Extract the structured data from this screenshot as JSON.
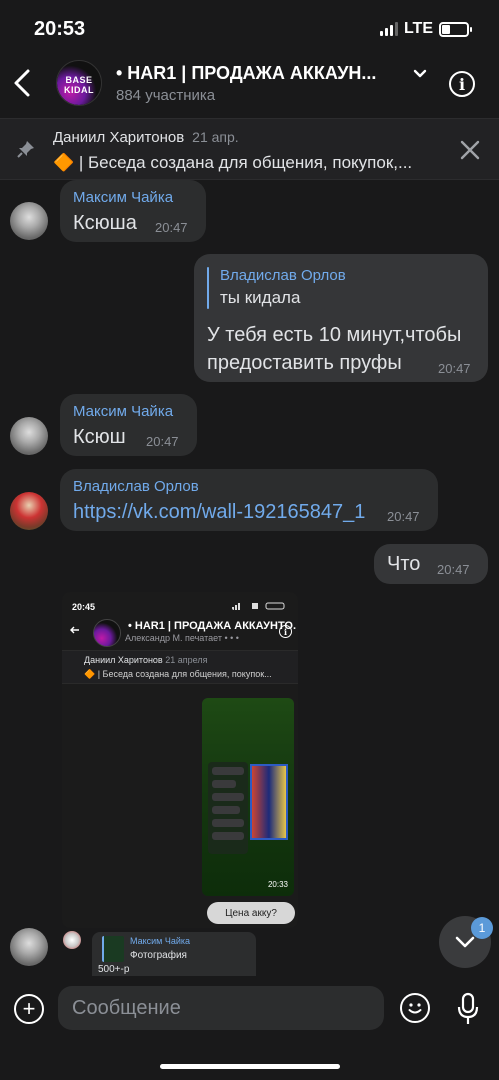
{
  "status_bar": {
    "time": "20:53",
    "network": "LTE"
  },
  "header": {
    "avatar_line1": "BASE",
    "avatar_line2": "KIDAL",
    "title": "• HAR1 | ПРОДАЖА АККАУН...",
    "subtitle": "884 участника"
  },
  "pinned": {
    "author": "Даниил Харитонов",
    "date": "21 апр.",
    "text": "🔶 | Беседа создана для общения, покупок,..."
  },
  "messages": [
    {
      "sender": "Максим Чайка",
      "text": "Ксюша",
      "time": "20:47"
    },
    {
      "reply_author": "Владислав Орлов",
      "reply_text": "ты кидала",
      "text_line1": "У тебя есть 10 минут,чтобы",
      "text_line2": "предоставить пруфы",
      "time": "20:47"
    },
    {
      "sender": "Максим Чайка",
      "text": "Ксюш",
      "time": "20:47"
    },
    {
      "sender": "Владислав Орлов",
      "text": "https://vk.com/wall-192165847_1",
      "time": "20:47"
    },
    {
      "text": "Что",
      "time": "20:47"
    }
  ],
  "screenshot": {
    "time": "20:45",
    "title": "• HAR1 | ПРОДАЖА АККАУНТО.",
    "subtitle": "Александр М. печатает • • •",
    "pin_author": "Даниил Харитонов",
    "pin_date": "21 апреля",
    "pin_text": "🔶 | Беседа создана для общения, покупок...",
    "phone_time": "20:33",
    "question": "Цена акку?"
  },
  "bottom_message": {
    "name": "Максим Чайка",
    "text": "Фотография",
    "body": "500+-р"
  },
  "scroll": {
    "badge": "1"
  },
  "composer": {
    "placeholder": "Сообщение"
  }
}
